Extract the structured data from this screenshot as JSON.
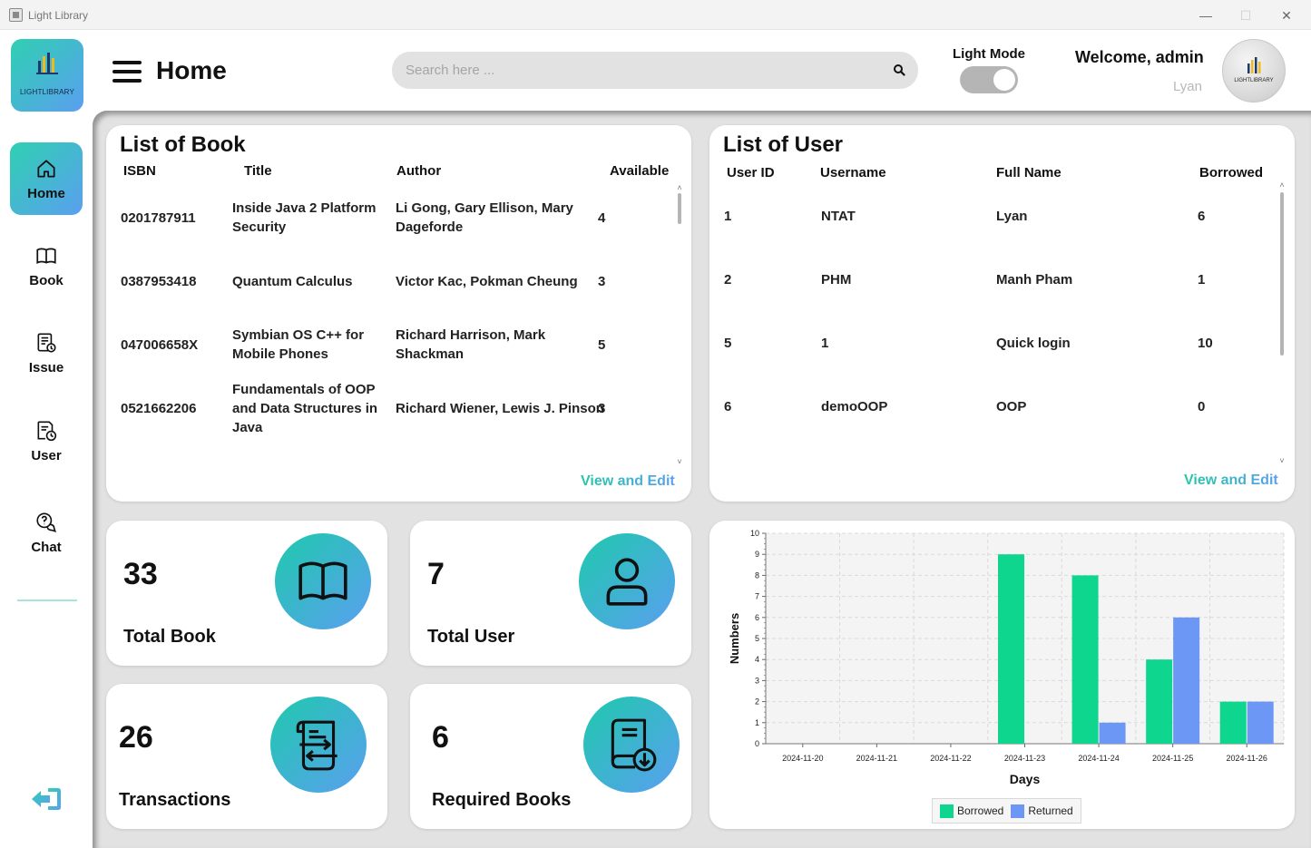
{
  "window": {
    "title": "Light Library",
    "minimize": "—",
    "maximize": "☐",
    "close": "✕"
  },
  "sidebar": {
    "logo_caption": "LIGHTLIBRARY",
    "items": [
      {
        "label": "Home",
        "icon": "home-icon",
        "active": true
      },
      {
        "label": "Book",
        "icon": "book-icon"
      },
      {
        "label": "Issue",
        "icon": "issue-icon"
      },
      {
        "label": "User",
        "icon": "user-doc-icon"
      },
      {
        "label": "Chat",
        "icon": "chat-icon"
      }
    ],
    "logout_icon": "logout-icon"
  },
  "header": {
    "title": "Home",
    "search_placeholder": "Search here ...",
    "mode_label": "Light Mode",
    "welcome": "Welcome, admin",
    "username": "Lyan",
    "avatar_caption": "LIGHTLIBRARY"
  },
  "books": {
    "title": "List of Book",
    "columns": [
      "ISBN",
      "Title",
      "Author",
      "Available"
    ],
    "rows": [
      {
        "isbn": "0201787911",
        "title": "Inside Java 2 Platform Security",
        "author": "Li Gong, Gary Ellison, Mary Dageforde",
        "available": "4"
      },
      {
        "isbn": "0387953418",
        "title": "Quantum Calculus",
        "author": "Victor Kac, Pokman Cheung",
        "available": "3"
      },
      {
        "isbn": "047006658X",
        "title": "Symbian OS C++ for Mobile Phones",
        "author": "Richard Harrison, Mark Shackman",
        "available": "5"
      },
      {
        "isbn": "0521662206",
        "title": "Fundamentals of OOP and Data Structures in Java",
        "author": "Richard Wiener, Lewis J. Pinson",
        "available": "3"
      }
    ],
    "view_edit": "View and Edit"
  },
  "users": {
    "title": "List of User",
    "columns": [
      "User ID",
      "Username",
      "Full Name",
      "Borrowed"
    ],
    "rows": [
      {
        "id": "1",
        "username": "NTAT",
        "fullname": "Lyan",
        "borrowed": "6"
      },
      {
        "id": "2",
        "username": "PHM",
        "fullname": "Manh Pham",
        "borrowed": "1"
      },
      {
        "id": "5",
        "username": "1",
        "fullname": "Quick login",
        "borrowed": "10"
      },
      {
        "id": "6",
        "username": "demoOOP",
        "fullname": "OOP",
        "borrowed": "0"
      }
    ],
    "view_edit": "View and Edit"
  },
  "stats": {
    "total_book": {
      "value": "33",
      "label": "Total Book"
    },
    "total_user": {
      "value": "7",
      "label": "Total User"
    },
    "transactions": {
      "value": "26",
      "label": "Transactions"
    },
    "required_books": {
      "value": "6",
      "label": "Required Books"
    }
  },
  "colors": {
    "accent_start": "#1fc9ad",
    "accent_end": "#5a9ff0",
    "borrowed": "#0fd68f",
    "returned": "#6d97f5"
  },
  "chart_data": {
    "type": "bar",
    "categories": [
      "2024-11-20",
      "2024-11-21",
      "2024-11-22",
      "2024-11-23",
      "2024-11-24",
      "2024-11-25",
      "2024-11-26"
    ],
    "series": [
      {
        "name": "Borrowed",
        "values": [
          0,
          0,
          0,
          9,
          8,
          4,
          2
        ]
      },
      {
        "name": "Returned",
        "values": [
          0,
          0,
          0,
          0,
          1,
          6,
          2
        ]
      }
    ],
    "xlabel": "Days",
    "ylabel": "Numbers",
    "ylim": [
      0,
      10
    ],
    "yticks": [
      "0",
      "1",
      "2",
      "3",
      "4",
      "5",
      "6",
      "7",
      "8",
      "9",
      "10"
    ],
    "grid": true,
    "legend": "bottom"
  }
}
